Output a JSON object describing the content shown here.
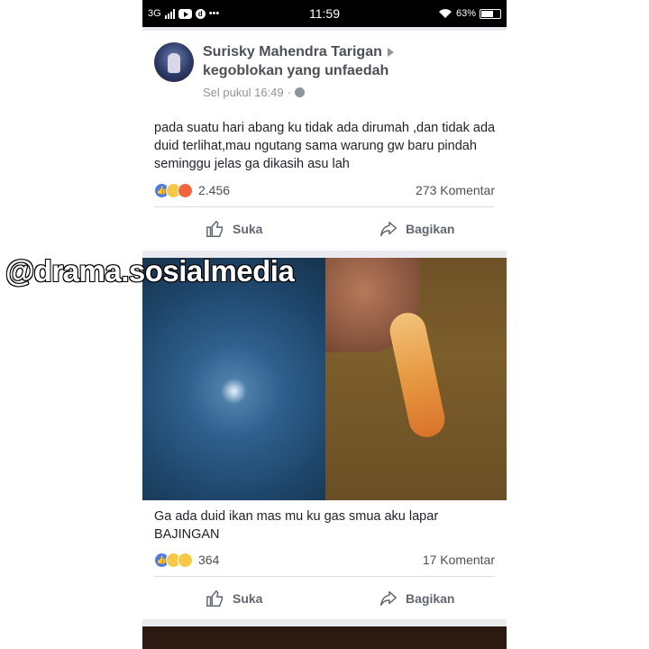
{
  "status_bar": {
    "network": "3G",
    "time": "11:59",
    "battery": "63%"
  },
  "watermark": "@drama.sosialmedia",
  "post1": {
    "author": "Surisky Mahendra Tarigan",
    "group": "kegoblokan yang unfaedah",
    "meta": "Sel pukul 16:49",
    "text": "pada suatu hari abang ku tidak ada dirumah ,dan tidak ada duid terlihat,mau ngutang sama warung gw baru pindah seminggu jelas ga dikasih asu lah",
    "reaction_count": "2.456",
    "comments": "273 Komentar",
    "like_label": "Suka",
    "share_label": "Bagikan"
  },
  "post2": {
    "text": "Ga ada duid ikan mas mu ku gas smua aku lapar BAJINGAN",
    "reaction_count": "364",
    "comments": "17 Komentar",
    "like_label": "Suka",
    "share_label": "Bagikan"
  }
}
